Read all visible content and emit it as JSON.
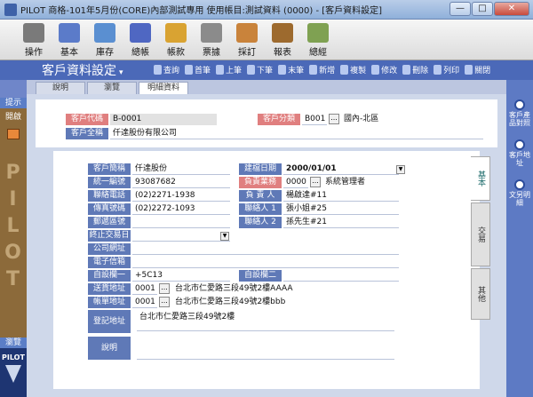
{
  "window": {
    "title": "PILOT 商格-101年5月份(CORE)內部測試專用 使用帳目:測試資料 (0000) - [客戶資料設定]",
    "min": "—",
    "max": "□",
    "close": "✕"
  },
  "toolbar": [
    {
      "label": "操作",
      "icon": "operate-icon",
      "color": "#7a7a7a"
    },
    {
      "label": "基本",
      "icon": "grid-icon",
      "color": "#5b7bc9"
    },
    {
      "label": "庫存",
      "icon": "stock-icon",
      "color": "#5a8fd1"
    },
    {
      "label": "總帳",
      "icon": "ledger-icon",
      "color": "#4f67c2"
    },
    {
      "label": "帳款",
      "icon": "account-icon",
      "color": "#d9a332"
    },
    {
      "label": "票據",
      "icon": "ticket-icon",
      "color": "#8b8b8b"
    },
    {
      "label": "採訂",
      "icon": "purchase-icon",
      "color": "#c9833b"
    },
    {
      "label": "報表",
      "icon": "report-icon",
      "color": "#9d6a2e"
    },
    {
      "label": "總經",
      "icon": "manager-icon",
      "color": "#7fa152"
    }
  ],
  "screen": {
    "title": "客戶資料設定",
    "arrow": "▾"
  },
  "nav": [
    {
      "label": "查詢",
      "name": "query"
    },
    {
      "label": "首筆",
      "name": "first"
    },
    {
      "label": "上筆",
      "name": "prev"
    },
    {
      "label": "下筆",
      "name": "next"
    },
    {
      "label": "末筆",
      "name": "last"
    },
    {
      "label": "新增",
      "name": "add"
    },
    {
      "label": "複製",
      "name": "copy"
    },
    {
      "label": "修改",
      "name": "edit"
    },
    {
      "label": "刪除",
      "name": "delete"
    },
    {
      "label": "列印",
      "name": "print"
    },
    {
      "label": "關閉",
      "name": "close"
    }
  ],
  "tabs": [
    "說明",
    "瀏覽",
    "明細資料"
  ],
  "left_sidebar": {
    "hint": "提示",
    "open": "開啟",
    "browse": "瀏覽",
    "logo": "PILOT",
    "watermark": "PILOT"
  },
  "right_sidebar": [
    {
      "label": "客戶產品對照"
    },
    {
      "label": "客戶地址"
    },
    {
      "label": "文另明細"
    }
  ],
  "header": {
    "code_label": "客戶代碼",
    "code_value": "B-0001",
    "cat_label": "客戶分類",
    "cat_value": "B001",
    "cat_name": "國內-北區",
    "fullname_label": "客戶全稱",
    "fullname_value": "仟達股份有限公司"
  },
  "form": {
    "short_name": {
      "label": "客戶簡稱",
      "value": "仟達股份"
    },
    "created": {
      "label": "建檔日期",
      "value": "2000/01/01"
    },
    "tax_id": {
      "label": "統一編號",
      "value": "93087682"
    },
    "sales": {
      "label": "負責業務",
      "value": "0000",
      "name": "系統管理者"
    },
    "phone": {
      "label": "聯絡電話",
      "value": "(02)2271-1938"
    },
    "owner": {
      "label": "負 責 人",
      "value": "楊啟達#11"
    },
    "fax": {
      "label": "傳真號碼",
      "value": "(02)2272-1093"
    },
    "contact1": {
      "label": "聯絡人 1",
      "value": "張小姐#25"
    },
    "zip": {
      "label": "郵遞區號",
      "value": ""
    },
    "contact2": {
      "label": "聯絡人 2",
      "value": "孫先生#21"
    },
    "terminate": {
      "label": "終止交易日",
      "value": ""
    },
    "website": {
      "label": "公司網址",
      "value": ""
    },
    "email": {
      "label": "電子信箱",
      "value": ""
    },
    "custom1": {
      "label": "自設欄一",
      "value": "+5C13"
    },
    "custom2": {
      "label": "自設欄二",
      "value": ""
    },
    "ship_addr": {
      "label": "送貨地址",
      "code": "0001",
      "value": "台北市仁愛路三段49號2樓AAAA"
    },
    "bill_addr": {
      "label": "帳單地址",
      "code": "0001",
      "value": "台北市仁愛路三段49號2樓bbb"
    },
    "reg_addr": {
      "label": "登記地址",
      "value": "台北市仁愛路三段49號2樓"
    },
    "notes": {
      "label": "說明",
      "value": ""
    }
  },
  "side_tabs": [
    "基本",
    "交易",
    "其他"
  ]
}
